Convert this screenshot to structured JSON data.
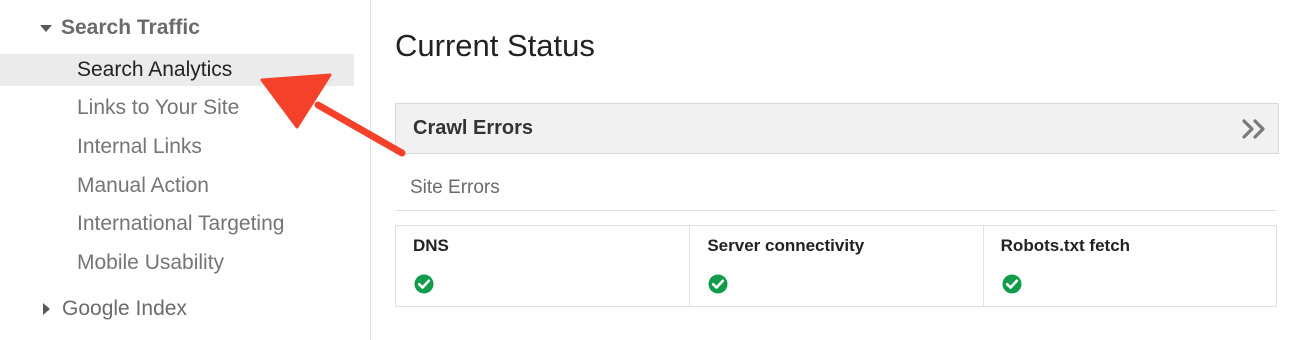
{
  "sidebar": {
    "section_open": "Search Traffic",
    "items": [
      {
        "label": "Search Analytics",
        "active": true
      },
      {
        "label": "Links to Your Site",
        "active": false
      },
      {
        "label": "Internal Links",
        "active": false
      },
      {
        "label": "Manual Action",
        "active": false
      },
      {
        "label": "International Targeting",
        "active": false
      },
      {
        "label": "Mobile Usability",
        "active": false
      }
    ],
    "section_closed": "Google Index"
  },
  "main": {
    "title": "Current Status",
    "crawl_errors": {
      "label": "Crawl Errors",
      "expand_icon": "double-chevron-right-icon"
    },
    "site_errors_label": "Site Errors",
    "status_cells": [
      {
        "label": "DNS",
        "status_icon": "check-circle-icon"
      },
      {
        "label": "Server connectivity",
        "status_icon": "check-circle-icon"
      },
      {
        "label": "Robots.txt fetch",
        "status_icon": "check-circle-icon"
      }
    ]
  },
  "colors": {
    "annotation_arrow": "#f5412a",
    "status_ok": "#109c4a",
    "active_item_bg": "#ebebeb"
  }
}
